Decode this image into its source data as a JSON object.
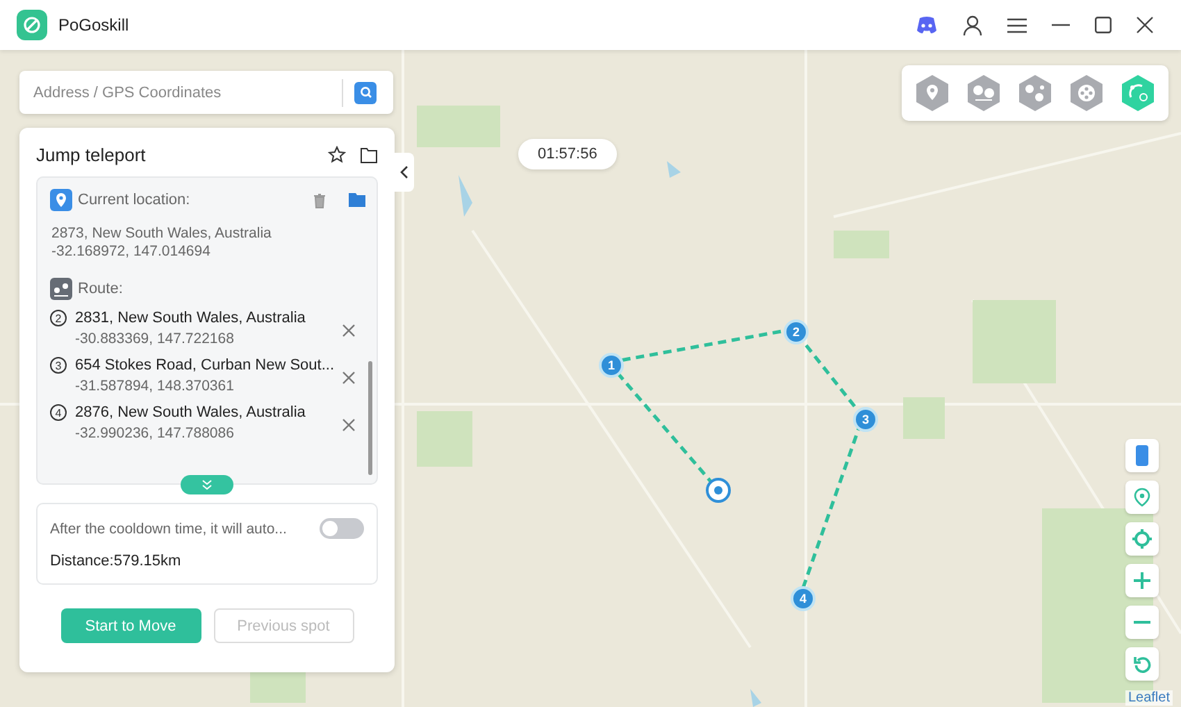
{
  "app": {
    "name": "PoGoskill"
  },
  "search": {
    "placeholder": "Address / GPS Coordinates"
  },
  "modes": [
    {
      "selected": false
    },
    {
      "selected": false
    },
    {
      "selected": false
    },
    {
      "selected": false
    },
    {
      "selected": true
    }
  ],
  "timer": "01:57:56",
  "panel": {
    "title": "Jump teleport",
    "current_label": "Current location:",
    "current_address": "2873, New South Wales, Australia",
    "current_coords": "-32.168972, 147.014694",
    "route_label": "Route:",
    "stops": [
      {
        "number": "2",
        "address": "2831, New South Wales, Australia",
        "coords": "-30.883369, 147.722168"
      },
      {
        "number": "3",
        "address": "654 Stokes Road, Curban New Sout...",
        "coords": "-31.587894, 148.370361"
      },
      {
        "number": "4",
        "address": "2876, New South Wales, Australia",
        "coords": "-32.990236, 147.788086"
      }
    ],
    "auto_text": "After the cooldown time, it will auto...",
    "auto_on": false,
    "distance": "Distance:579.15km",
    "buttons": [
      {
        "label": "Start to Move",
        "kind": "primary"
      },
      {
        "label": "Previous spot",
        "kind": "disabled"
      }
    ]
  },
  "route_markers": [
    "1",
    "2",
    "3",
    "4"
  ],
  "attribution": "Leaflet"
}
